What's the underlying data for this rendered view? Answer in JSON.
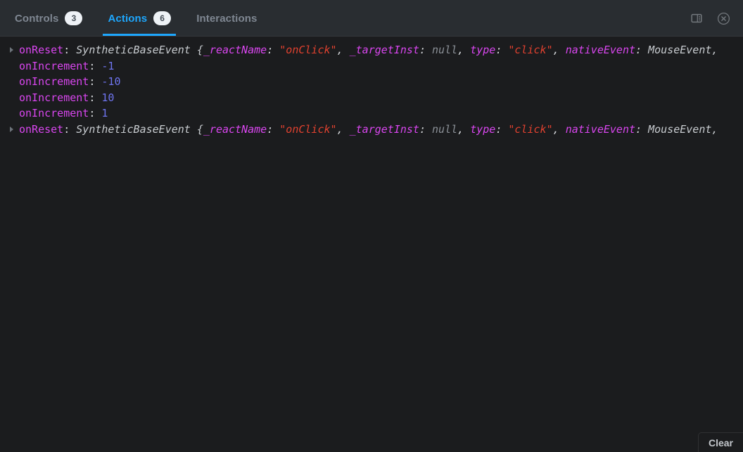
{
  "panel": {
    "tabs": [
      {
        "label": "Controls",
        "badge": "3",
        "active": false,
        "name": "tab-controls"
      },
      {
        "label": "Actions",
        "badge": "6",
        "active": true,
        "name": "tab-actions"
      },
      {
        "label": "Interactions",
        "badge": null,
        "active": false,
        "name": "tab-interactions"
      }
    ],
    "toolbar": {
      "layout_icon": "panel-layout-icon",
      "close_icon": "close-circle-icon"
    },
    "accent_color": "#1ea7fd",
    "background_color": "#1b1c1e",
    "tabbar_background_color": "#292d31"
  },
  "log": {
    "entries": [
      {
        "expandable": true,
        "segments": [
          {
            "text": "onReset",
            "type": "key"
          },
          {
            "text": ": ",
            "type": "punct"
          },
          {
            "text": "SyntheticBaseEvent {",
            "type": "ctor"
          },
          {
            "text": "_reactName",
            "type": "prop"
          },
          {
            "text": ": ",
            "type": "sep"
          },
          {
            "text": "\"onClick\"",
            "type": "str"
          },
          {
            "text": ", ",
            "type": "sep"
          },
          {
            "text": "_targetInst",
            "type": "prop"
          },
          {
            "text": ": ",
            "type": "sep"
          },
          {
            "text": "null",
            "type": "null"
          },
          {
            "text": ", ",
            "type": "sep"
          },
          {
            "text": "type",
            "type": "prop"
          },
          {
            "text": ": ",
            "type": "sep"
          },
          {
            "text": "\"click\"",
            "type": "str"
          },
          {
            "text": ", ",
            "type": "sep"
          },
          {
            "text": "nativeEvent",
            "type": "prop"
          },
          {
            "text": ": ",
            "type": "sep"
          },
          {
            "text": "MouseEvent, ",
            "type": "plain"
          }
        ]
      },
      {
        "expandable": false,
        "segments": [
          {
            "text": "onIncrement",
            "type": "key"
          },
          {
            "text": ": ",
            "type": "punct"
          },
          {
            "text": "-1",
            "type": "num"
          }
        ]
      },
      {
        "expandable": false,
        "segments": [
          {
            "text": "onIncrement",
            "type": "key"
          },
          {
            "text": ": ",
            "type": "punct"
          },
          {
            "text": "-10",
            "type": "num"
          }
        ]
      },
      {
        "expandable": false,
        "segments": [
          {
            "text": "onIncrement",
            "type": "key"
          },
          {
            "text": ": ",
            "type": "punct"
          },
          {
            "text": "10",
            "type": "num"
          }
        ]
      },
      {
        "expandable": false,
        "segments": [
          {
            "text": "onIncrement",
            "type": "key"
          },
          {
            "text": ": ",
            "type": "punct"
          },
          {
            "text": "1",
            "type": "num"
          }
        ]
      },
      {
        "expandable": true,
        "segments": [
          {
            "text": "onReset",
            "type": "key"
          },
          {
            "text": ": ",
            "type": "punct"
          },
          {
            "text": "SyntheticBaseEvent {",
            "type": "ctor"
          },
          {
            "text": "_reactName",
            "type": "prop"
          },
          {
            "text": ": ",
            "type": "sep"
          },
          {
            "text": "\"onClick\"",
            "type": "str"
          },
          {
            "text": ", ",
            "type": "sep"
          },
          {
            "text": "_targetInst",
            "type": "prop"
          },
          {
            "text": ": ",
            "type": "sep"
          },
          {
            "text": "null",
            "type": "null"
          },
          {
            "text": ", ",
            "type": "sep"
          },
          {
            "text": "type",
            "type": "prop"
          },
          {
            "text": ": ",
            "type": "sep"
          },
          {
            "text": "\"click\"",
            "type": "str"
          },
          {
            "text": ", ",
            "type": "sep"
          },
          {
            "text": "nativeEvent",
            "type": "prop"
          },
          {
            "text": ": ",
            "type": "sep"
          },
          {
            "text": "MouseEvent, ",
            "type": "plain"
          }
        ]
      }
    ]
  },
  "footer": {
    "clear_label": "Clear"
  }
}
